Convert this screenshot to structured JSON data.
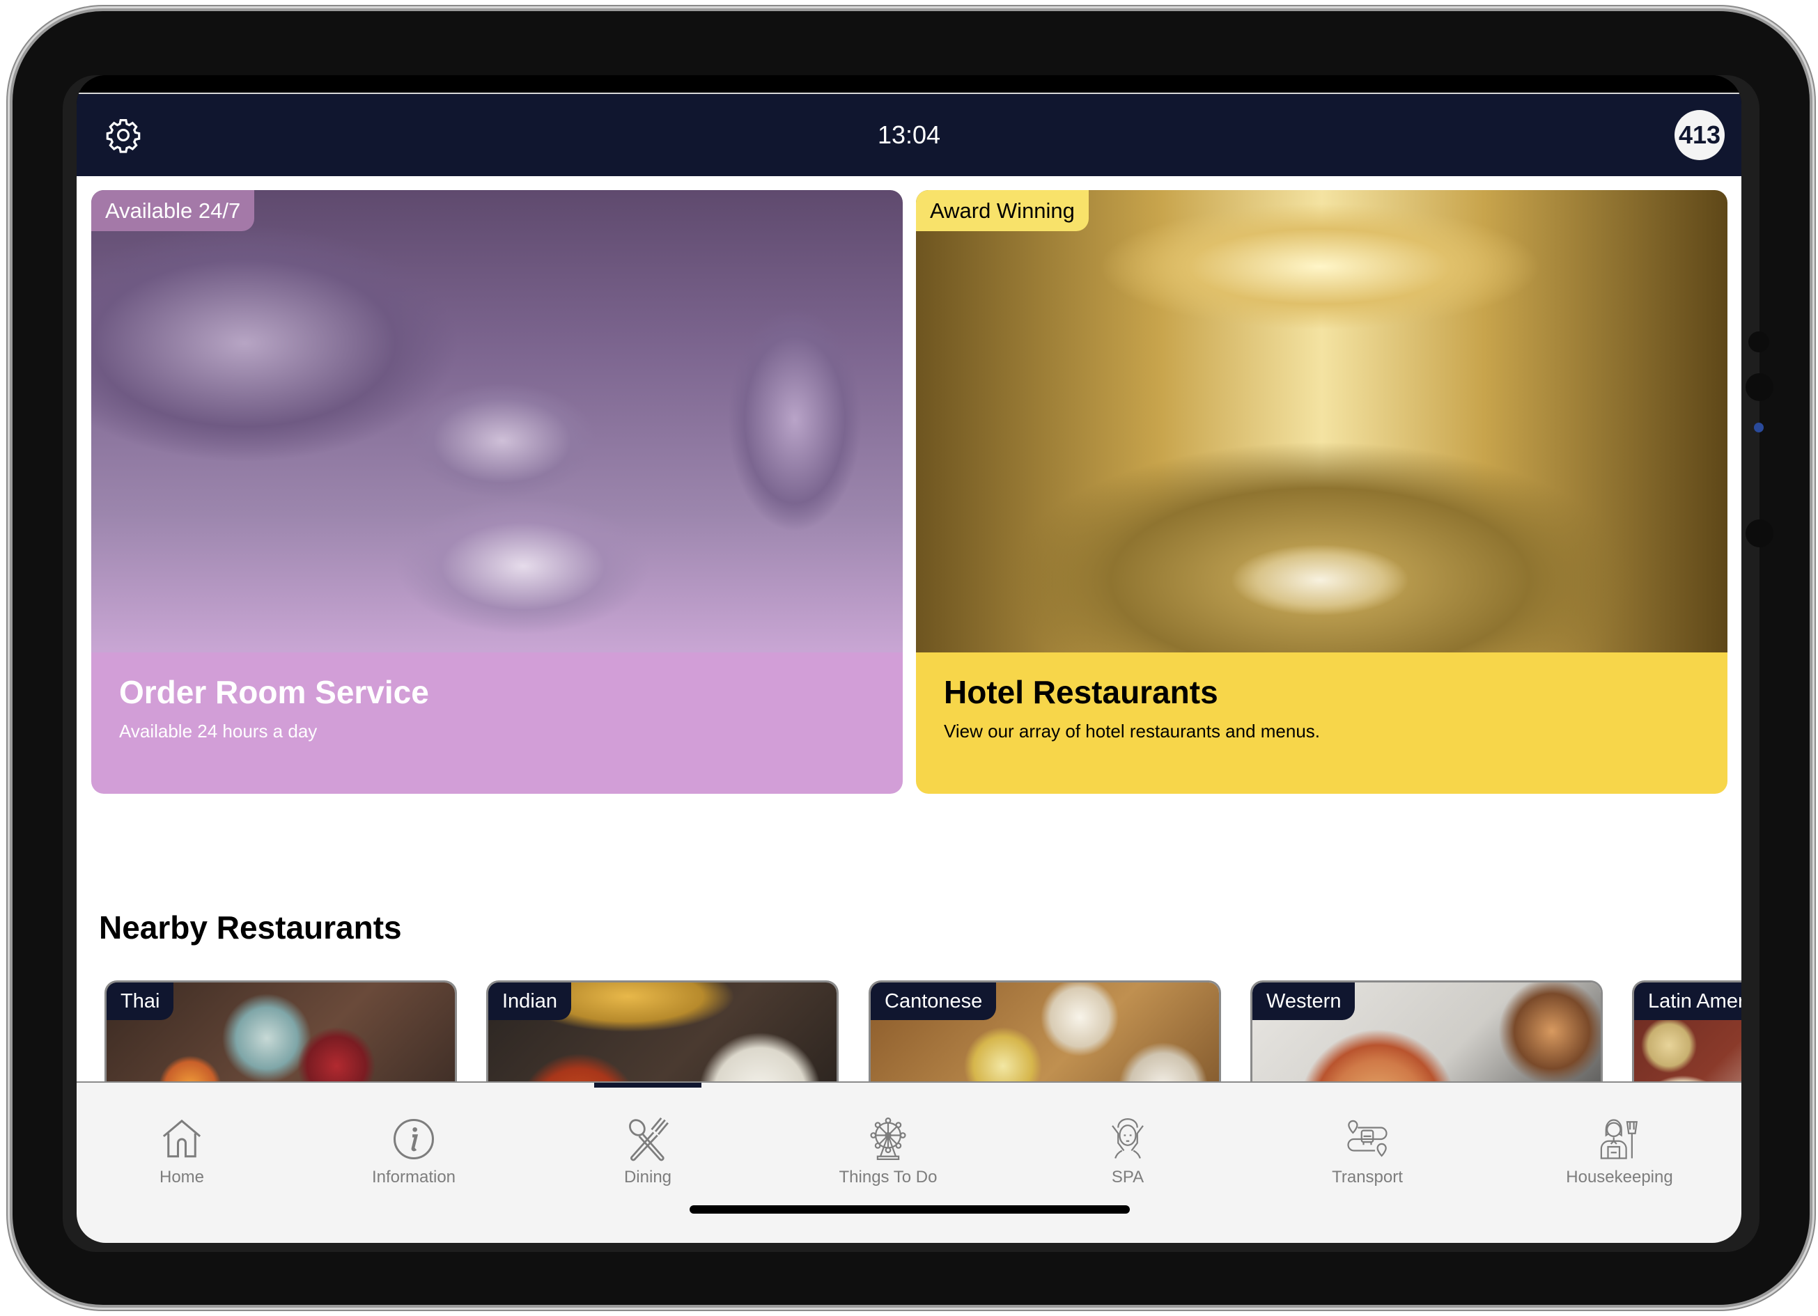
{
  "header": {
    "time": "13:04",
    "room_number": "413",
    "settings_icon": "gear-icon"
  },
  "promos": [
    {
      "tag": "Available 24/7",
      "title": "Order Room Service",
      "subtitle": "Available 24 hours a day",
      "image": "room-service-photo",
      "panel_color": "#d29ed7"
    },
    {
      "tag": "Award Winning",
      "title": "Hotel Restaurants",
      "subtitle": "View our array of hotel restaurants and menus.",
      "image": "restaurant-interior-photo",
      "panel_color": "#f7d64a"
    }
  ],
  "nearby": {
    "title": "Nearby Restaurants",
    "items": [
      {
        "label": "Thai",
        "image": "thai-food-photo"
      },
      {
        "label": "Indian",
        "image": "indian-food-photo"
      },
      {
        "label": "Cantonese",
        "image": "dim-sum-photo"
      },
      {
        "label": "Western",
        "image": "pizza-photo"
      },
      {
        "label": "Latin American",
        "image": "tacos-photo"
      }
    ]
  },
  "tabs": [
    {
      "label": "Home",
      "icon": "home-icon"
    },
    {
      "label": "Information",
      "icon": "info-icon"
    },
    {
      "label": "Dining",
      "icon": "dining-icon",
      "active": true
    },
    {
      "label": "Things To Do",
      "icon": "ferris-wheel-icon"
    },
    {
      "label": "SPA",
      "icon": "spa-icon"
    },
    {
      "label": "Transport",
      "icon": "transport-icon"
    },
    {
      "label": "Housekeeping",
      "icon": "housekeeping-icon"
    }
  ],
  "colors": {
    "header_bg": "#10162f",
    "tabbar_bg": "#f4f4f4",
    "tab_text": "#7d7d7d",
    "tag_bg": "#10162f"
  }
}
